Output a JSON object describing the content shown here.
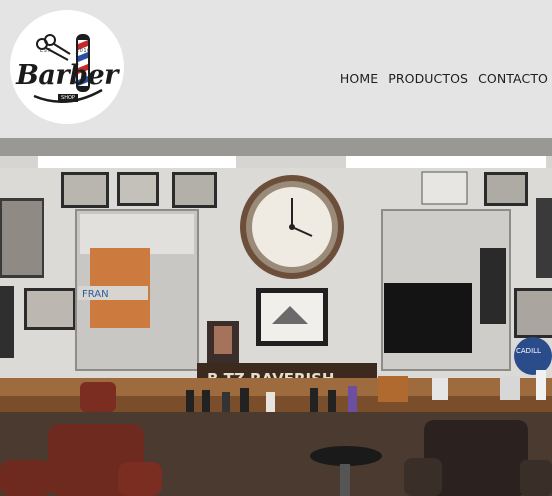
{
  "logo": {
    "name": "Barber",
    "est_left": "EST.",
    "est_right": "2016",
    "shop": "SHOP"
  },
  "nav": {
    "items": [
      {
        "label": "HOME"
      },
      {
        "label": "PRODUCTOS"
      },
      {
        "label": "CONTACTO"
      }
    ]
  },
  "hero": {
    "signboard_text": "B  TZ  RAVERISH",
    "mirror_sign_text": "FRAN",
    "round_sign_text": "CADILL"
  },
  "colors": {
    "header_bg": "#e4e4e4",
    "counter_wood": "#8a5a34",
    "chair_leather": "#7a2d20"
  }
}
